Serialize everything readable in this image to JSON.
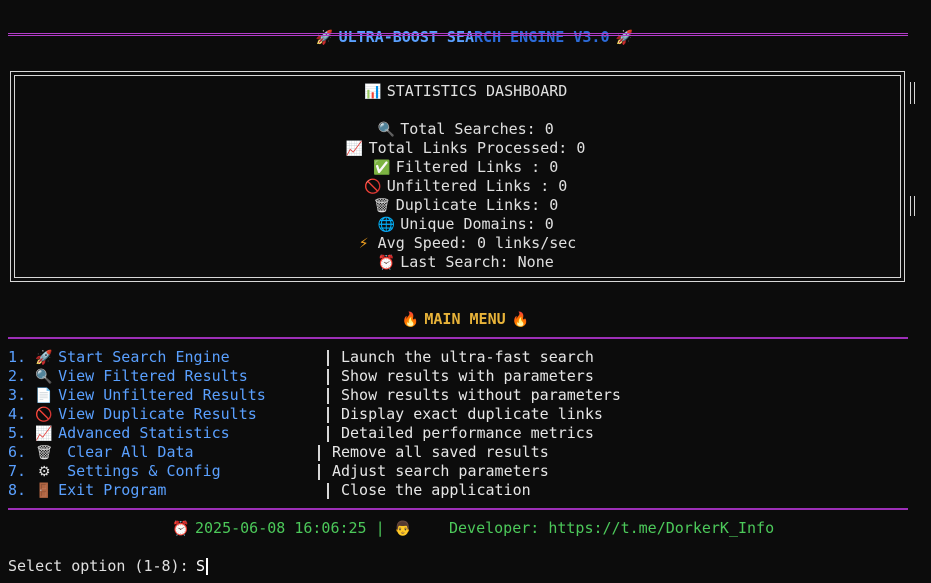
{
  "header": {
    "rocket_icon": "rocket-icon",
    "title_part1": "ULTRA-BOOST SEA",
    "title_part2": "RCH ENGINE V3.0"
  },
  "stats": {
    "title": "STATISTICS DASHBOARD",
    "total_searches": "Total Searches: 0",
    "total_links": "Total Links Processed: 0",
    "filtered": "Filtered Links : 0",
    "unfiltered": "Unfiltered Links : 0",
    "duplicate": "Duplicate Links: 0",
    "unique_domains": "Unique Domains: 0",
    "avg_speed": "Avg Speed: 0 links/sec",
    "last_search": "Last Search: None"
  },
  "menu": {
    "title": "MAIN MENU",
    "items": [
      {
        "num": "1.",
        "label": "Start Search Engine",
        "desc": "Launch the ultra-fast search"
      },
      {
        "num": "2.",
        "label": "View Filtered Results",
        "desc": "Show results with parameters"
      },
      {
        "num": "3.",
        "label": "View Unfiltered Results",
        "desc": "Show results without parameters"
      },
      {
        "num": "4.",
        "label": "View Duplicate Results",
        "desc": "Display exact duplicate links"
      },
      {
        "num": "5.",
        "label": "Advanced Statistics",
        "desc": "Detailed performance metrics"
      },
      {
        "num": "6.",
        "label": " Clear All Data",
        "desc": "Remove all saved results"
      },
      {
        "num": "7.",
        "label": " Settings & Config",
        "desc": "Adjust search parameters"
      },
      {
        "num": "8.",
        "label": "Exit Program",
        "desc": "Close the application"
      }
    ]
  },
  "footer": {
    "datetime": "2025-06-08 16:06:25",
    "separator": "|",
    "developer": "Developer: https://t.me/DorkerK_Info"
  },
  "prompt": {
    "text": "Select option (1-8):",
    "input_value": "S"
  }
}
